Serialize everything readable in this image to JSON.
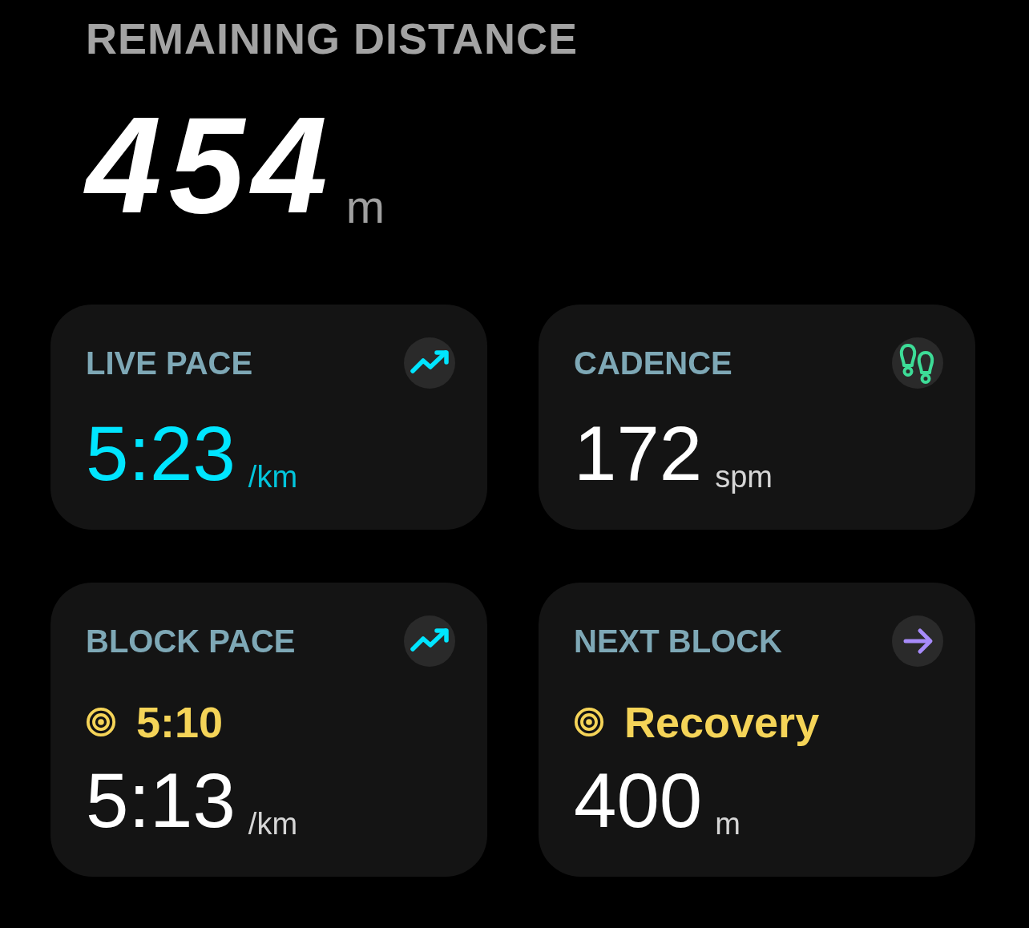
{
  "remaining_distance": {
    "label": "REMAINING DISTANCE",
    "value": "454",
    "unit": "m"
  },
  "cards": [
    {
      "kind": "live_pace",
      "label": "LIVE PACE",
      "color": "#00e5ff",
      "value": "5:23",
      "unit": "/km"
    },
    {
      "kind": "cadence",
      "label": "CADENCE",
      "color": "#3ddc97",
      "value": "172",
      "unit": "spm"
    },
    {
      "kind": "block_pace",
      "label": "BLOCK PACE",
      "color": "#00e5ff",
      "target": "5:10",
      "value": "5:13",
      "unit": "/km"
    },
    {
      "kind": "next_block",
      "label": "NEXT BLOCK",
      "color": "#a78bfa",
      "target": "Recovery",
      "value": "400",
      "unit": "m"
    }
  ]
}
